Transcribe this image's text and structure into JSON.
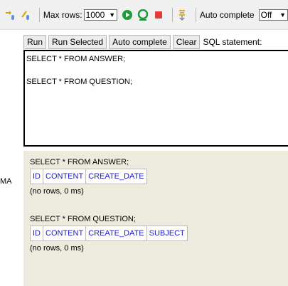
{
  "toolbar": {
    "max_rows_label": "Max rows:",
    "max_rows_value": "1000",
    "auto_complete_label": "Auto complete",
    "auto_complete_value": "Off"
  },
  "buttons": {
    "run": "Run",
    "run_selected": "Run Selected",
    "auto_complete": "Auto complete",
    "clear": "Clear",
    "sql_statement_label": "SQL statement:"
  },
  "editor": {
    "text": "SELECT * FROM ANSWER;\n\nSELECT * FROM QUESTION;"
  },
  "left_panel": {
    "label": "MA"
  },
  "results": [
    {
      "statement": "SELECT * FROM ANSWER;",
      "columns": [
        "ID",
        "CONTENT",
        "CREATE_DATE"
      ],
      "status": "(no rows, 0 ms)"
    },
    {
      "statement": "SELECT * FROM QUESTION;",
      "columns": [
        "ID",
        "CONTENT",
        "CREATE_DATE",
        "SUBJECT"
      ],
      "status": "(no rows, 0 ms)"
    }
  ],
  "colors": {
    "results_bg": "#ecebdd",
    "column_header_text": "#1a1acc",
    "toolbar_bg": "#f0f0f0"
  }
}
